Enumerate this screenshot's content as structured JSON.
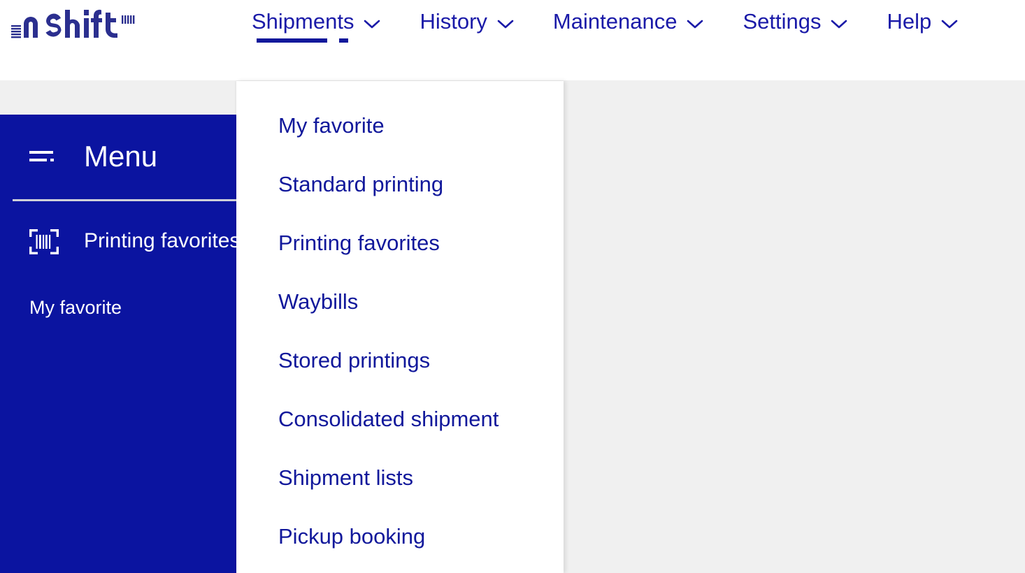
{
  "brand": {
    "logo_text": "nShift",
    "logo_color": "#2b2f8f",
    "accent_blue": "#11189b",
    "sidebar_blue": "#0b14a0",
    "page_background": "#f0f0f0"
  },
  "topnav": {
    "items": [
      {
        "label": "Shipments",
        "icon": "chevron-down-icon",
        "active": true
      },
      {
        "label": "History",
        "icon": "chevron-down-icon",
        "active": false
      },
      {
        "label": "Maintenance",
        "icon": "chevron-down-icon",
        "active": false
      },
      {
        "label": "Settings",
        "icon": "chevron-down-icon",
        "active": false
      },
      {
        "label": "Help",
        "icon": "chevron-down-icon",
        "active": false
      }
    ]
  },
  "sidebar": {
    "toggle_icon": "hamburger-menu-icon",
    "title": "Menu",
    "items": [
      {
        "label": "Printing favorites",
        "icon": "barcode-scan-icon"
      }
    ],
    "sub_items": [
      {
        "label": "My favorite"
      }
    ]
  },
  "dropdown": {
    "owner": "Shipments",
    "items": [
      {
        "label": "My favorite"
      },
      {
        "label": "Standard printing"
      },
      {
        "label": "Printing favorites"
      },
      {
        "label": "Waybills"
      },
      {
        "label": "Stored printings"
      },
      {
        "label": "Consolidated shipment"
      },
      {
        "label": "Shipment lists"
      },
      {
        "label": "Pickup booking"
      }
    ]
  }
}
